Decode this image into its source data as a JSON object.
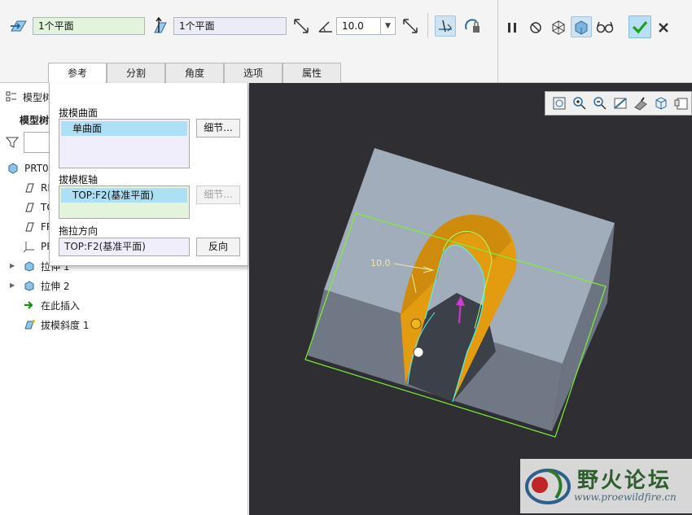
{
  "toolbar": {
    "surface_ref": "1个平面",
    "pull_ref": "1个平面",
    "angle_value": "10.0"
  },
  "tabs": [
    {
      "label": "参考"
    },
    {
      "label": "分割"
    },
    {
      "label": "角度"
    },
    {
      "label": "选项"
    },
    {
      "label": "属性"
    }
  ],
  "tree": {
    "header": "模型树",
    "subheader": "模型树",
    "items": [
      {
        "label": "PRT0"
      },
      {
        "label": "RI"
      },
      {
        "label": "TO"
      },
      {
        "label": "FR"
      },
      {
        "label": "PR"
      },
      {
        "label": "拉伸 1"
      },
      {
        "label": "拉伸 2"
      },
      {
        "label": "在此插入"
      },
      {
        "label": "拔模斜度 1"
      }
    ]
  },
  "ref_panel": {
    "draft_surfaces_label": "拔模曲面",
    "draft_surfaces_item": "单曲面",
    "details_button": "细节...",
    "draft_hinge_label": "拔模枢轴",
    "draft_hinge_item": "TOP:F2(基准平面)",
    "details_button_2": "细节...",
    "pull_direction_label": "拖拉方向",
    "pull_direction_value": "TOP:F2(基准平面)",
    "flip_button": "反向"
  },
  "viewport": {
    "dimension_label": "10.0"
  },
  "watermark": {
    "title": "野火论坛",
    "url": "www.proewildfire.cn"
  },
  "colors": {
    "accent": "#aee0f5",
    "ok": "#1aa31a",
    "background_3d": "#2e2e33",
    "part_top": "#a2adbb",
    "feature_orange": "#e09a0c"
  }
}
